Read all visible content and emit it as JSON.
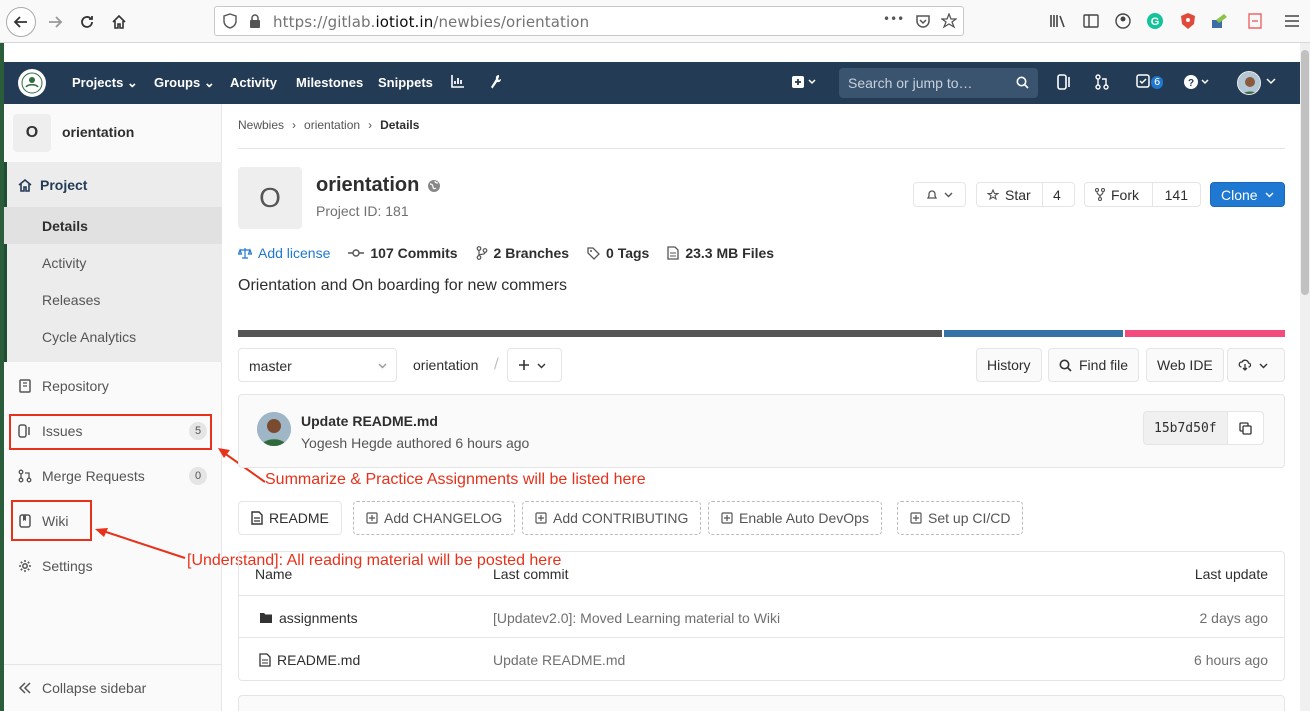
{
  "browser": {
    "url_prefix": "https://gitlab.",
    "url_host": "iotiot.in",
    "url_path": "/newbies/orientation",
    "more": "•••"
  },
  "navbar": {
    "projects": "Projects",
    "groups": "Groups",
    "activity": "Activity",
    "milestones": "Milestones",
    "snippets": "Snippets",
    "search_placeholder": "Search or jump to…",
    "todo_count": "6"
  },
  "sidebar": {
    "avatar_letter": "O",
    "project_name": "orientation",
    "project_section": "Project",
    "sub_items": [
      "Details",
      "Activity",
      "Releases",
      "Cycle Analytics"
    ],
    "repository": "Repository",
    "issues": "Issues",
    "issues_count": "5",
    "merge_requests": "Merge Requests",
    "mr_count": "0",
    "wiki": "Wiki",
    "settings": "Settings",
    "collapse": "Collapse sidebar"
  },
  "annotations": {
    "issues_note": "Summarize & Practice Assignments will be listed here",
    "wiki_note": "[Understand]: All reading material will be posted here",
    "color": "#e8311b"
  },
  "breadcrumb": {
    "group": "Newbies",
    "project": "orientation",
    "current": "Details"
  },
  "project": {
    "avatar_letter": "O",
    "title": "orientation",
    "project_id": "Project ID: 181",
    "star_label": "Star",
    "star_count": "4",
    "fork_label": "Fork",
    "fork_count": "141",
    "clone_label": "Clone",
    "add_license": "Add license",
    "commits": "107 Commits",
    "branches": "2 Branches",
    "tags": "0 Tags",
    "files": "23.3 MB Files",
    "description": "Orientation and On boarding for new commers"
  },
  "languages": [
    {
      "fraction": 0.674,
      "color": "#555555"
    },
    {
      "fraction": 0.173,
      "color": "#3572a5"
    },
    {
      "fraction": 0.153,
      "color": "#f34b7d"
    }
  ],
  "repo_toolbar": {
    "branch": "master",
    "path": "orientation",
    "path_sep": "/",
    "history": "History",
    "find_file": "Find file",
    "web_ide": "Web IDE"
  },
  "last_commit": {
    "title": "Update README.md",
    "author": "Yogesh Hegde authored 6 hours ago",
    "sha": "15b7d50f"
  },
  "quick_buttons": [
    "README",
    "Add CHANGELOG",
    "Add CONTRIBUTING",
    "Enable Auto DevOps",
    "Set up CI/CD"
  ],
  "file_tree": {
    "headers": {
      "name": "Name",
      "last_commit": "Last commit",
      "last_update": "Last update"
    },
    "rows": [
      {
        "name": "assignments",
        "commit": "[Updatev2.0]: Moved Learning material to Wiki",
        "updated": "2 days ago"
      },
      {
        "name": "README.md",
        "commit": "Update README.md",
        "updated": "6 hours ago"
      }
    ]
  }
}
